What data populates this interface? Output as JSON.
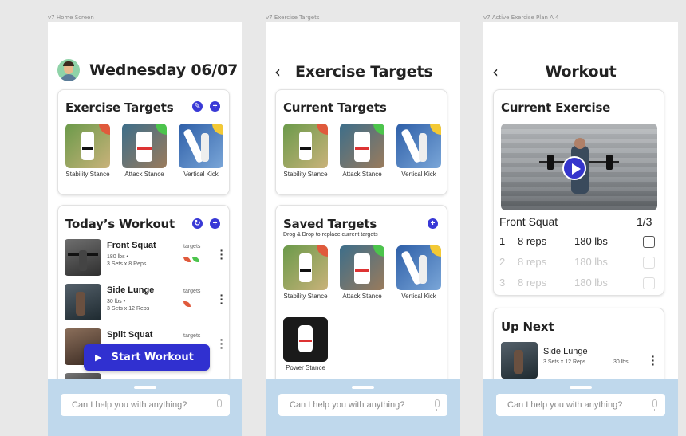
{
  "colors": {
    "accent": "#3939d6",
    "assistant_bg": "#bfd8ec",
    "red": "#e05a3c",
    "green": "#4cc44c",
    "yellow": "#f3c935"
  },
  "frames": {
    "home": "v7 Home Screen",
    "targets": "v7 Exercise Targets",
    "active": "v7 Active Exercise Plan A 4"
  },
  "home": {
    "date_title": "Wednesday 06/07",
    "targets_card": {
      "title": "Exercise Targets",
      "edit_icon": "pencil-icon",
      "add_icon": "plus-icon",
      "items": [
        {
          "label": "Stability Stance",
          "badge": "red"
        },
        {
          "label": "Attack Stance",
          "badge": "green"
        },
        {
          "label": "Vertical Kick",
          "badge": "yellow"
        }
      ]
    },
    "workout_card": {
      "title": "Today’s Workout",
      "refresh_icon": "refresh-icon",
      "add_icon": "plus-icon",
      "items": [
        {
          "name": "Front Squat",
          "detail": "180 lbs •\n3 Sets x 8 Reps",
          "targets_label": "targets"
        },
        {
          "name": "Side Lunge",
          "detail": "30 lbs •\n3 Sets x 12 Reps",
          "targets_label": "targets"
        },
        {
          "name": "Split Squat",
          "detail": "",
          "targets_label": "targets"
        }
      ]
    },
    "start_button": "Start Workout"
  },
  "targets_screen": {
    "title": "Exercise Targets",
    "current": {
      "title": "Current Targets",
      "items": [
        {
          "label": "Stability Stance",
          "badge": "red"
        },
        {
          "label": "Attack Stance",
          "badge": "green"
        },
        {
          "label": "Vertical Kick",
          "badge": "yellow"
        }
      ]
    },
    "saved": {
      "title": "Saved Targets",
      "hint": "Drog & Drop to replace current targets",
      "items": [
        {
          "label": "Stability Stance",
          "badge": "red"
        },
        {
          "label": "Attack Stance",
          "badge": "green"
        },
        {
          "label": "Vertical Kick",
          "badge": "yellow"
        },
        {
          "label": "Power Stance",
          "badge": ""
        }
      ]
    }
  },
  "workout_screen": {
    "title": "Workout",
    "current_card": {
      "title": "Current Exercise",
      "exercise_name": "Front Squat",
      "set_counter": "1/3",
      "sets": [
        {
          "num": "1",
          "reps": "8 reps",
          "weight": "180 lbs",
          "active": true
        },
        {
          "num": "2",
          "reps": "8 reps",
          "weight": "180 lbs",
          "active": false
        },
        {
          "num": "3",
          "reps": "8 reps",
          "weight": "180 lbs",
          "active": false
        }
      ]
    },
    "up_next": {
      "title": "Up Next",
      "name": "Side Lunge",
      "detail": "3 Sets x 12 Reps",
      "weight": "30 lbs"
    }
  },
  "assistant": {
    "placeholder": "Can I help you with anything?"
  }
}
